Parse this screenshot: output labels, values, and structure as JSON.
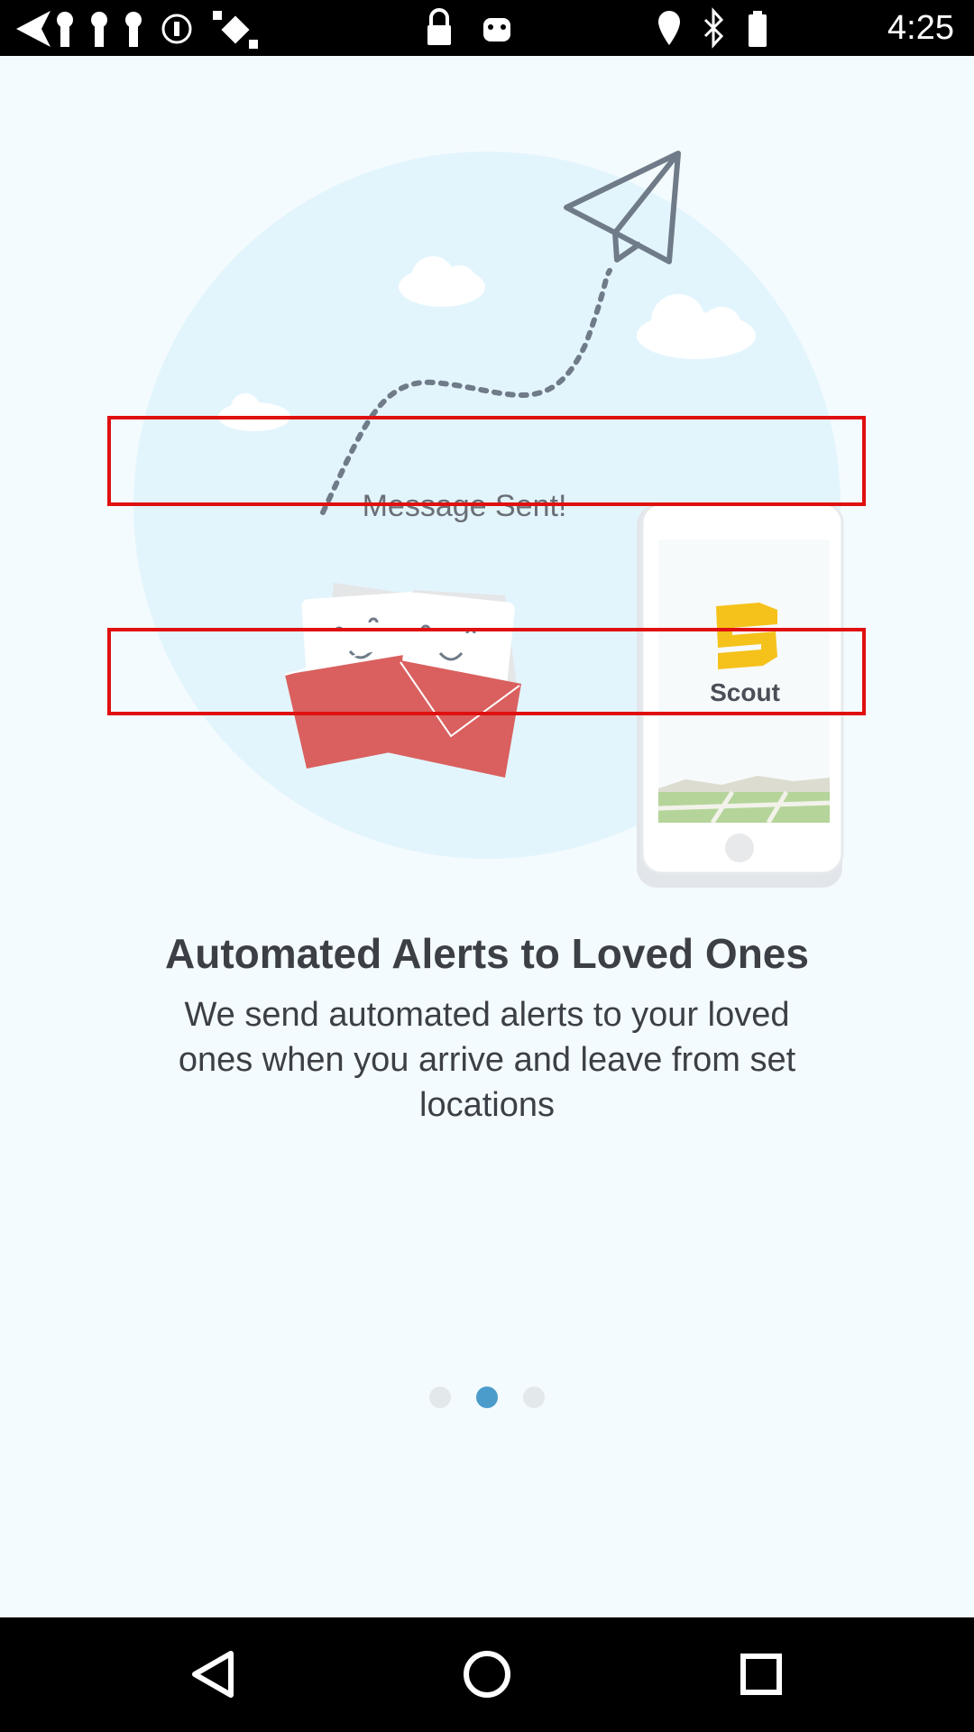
{
  "status_bar": {
    "time": "4:25",
    "left_icons": [
      "back-arrow-icon",
      "keyhole-icon",
      "keyhole-icon",
      "keyhole-icon",
      "info-icon",
      "satellite-icon",
      "lock-icon",
      "android-icon"
    ],
    "right_icons": [
      "location-icon",
      "bluetooth-icon",
      "battery-icon"
    ]
  },
  "illustration": {
    "message_text": "Message Sent!",
    "app_name": "Scout",
    "colors": {
      "circle": "#e3f5fc",
      "envelope": "#d9605f",
      "logo": "#f5c21b"
    }
  },
  "onboarding": {
    "title": "Automated Alerts to Loved Ones",
    "description": "We send automated alerts to your loved ones when you arrive and leave from set locations"
  },
  "pager": {
    "total": 3,
    "active_index": 1
  },
  "nav_bar": {
    "buttons": [
      "back-icon",
      "home-icon",
      "recents-icon"
    ]
  }
}
